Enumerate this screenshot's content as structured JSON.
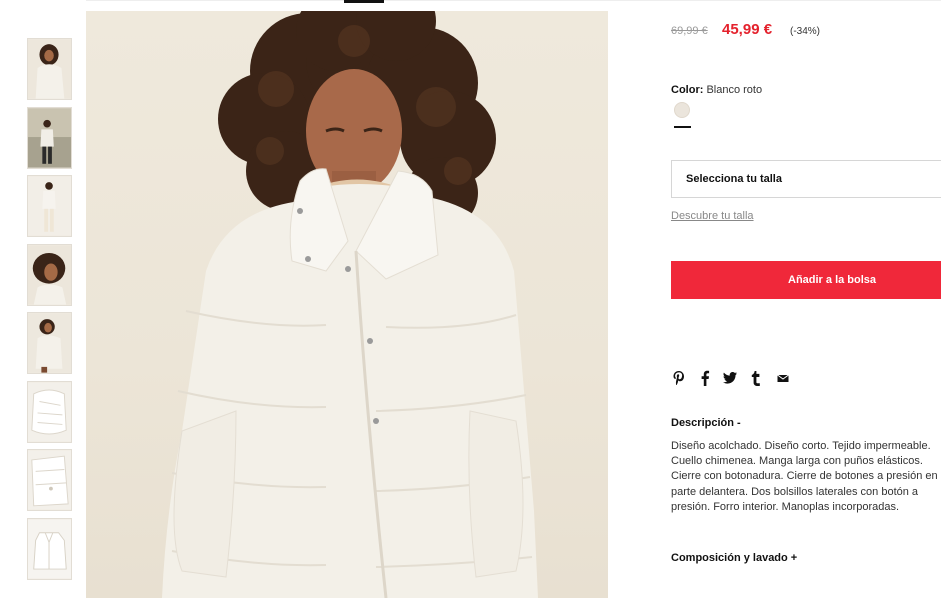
{
  "gallery": {
    "thumbnails": [
      {
        "alt": "thumb-1"
      },
      {
        "alt": "thumb-2"
      },
      {
        "alt": "thumb-3"
      },
      {
        "alt": "thumb-4"
      },
      {
        "alt": "thumb-5"
      },
      {
        "alt": "thumb-6"
      },
      {
        "alt": "thumb-7"
      },
      {
        "alt": "thumb-8"
      }
    ]
  },
  "product": {
    "price_old": "69,99 €",
    "price_new": "45,99 €",
    "discount": "(-34%)",
    "color_label": "Color:",
    "color_value": "Blanco roto",
    "swatch_color": "#ebe5dc",
    "size_select_label": "Selecciona tu talla",
    "size_guide_label": "Descubre tu talla",
    "add_to_bag_label": "Añadir a la bolsa",
    "description_title": "Descripción -",
    "description_text": "Diseño acolchado. Diseño corto. Tejido impermeable. Cuello chimenea. Manga larga con puños elásticos. Cierre con botonadura. Cierre de botones a presión en la parte delantera. Dos bolsillos laterales con botón a presión. Forro interior. Manoplas incorporadas.",
    "composition_title": "Composición y lavado +"
  },
  "share": {
    "icons": [
      "pinterest-icon",
      "facebook-icon",
      "twitter-icon",
      "tumblr-icon",
      "email-icon"
    ],
    "glyphs": [
      "𝓅",
      "f",
      "🐦",
      "t",
      "✉"
    ]
  },
  "colors": {
    "accent_red": "#e4222d",
    "button_red": "#f0283a",
    "text_dark": "#111111"
  }
}
